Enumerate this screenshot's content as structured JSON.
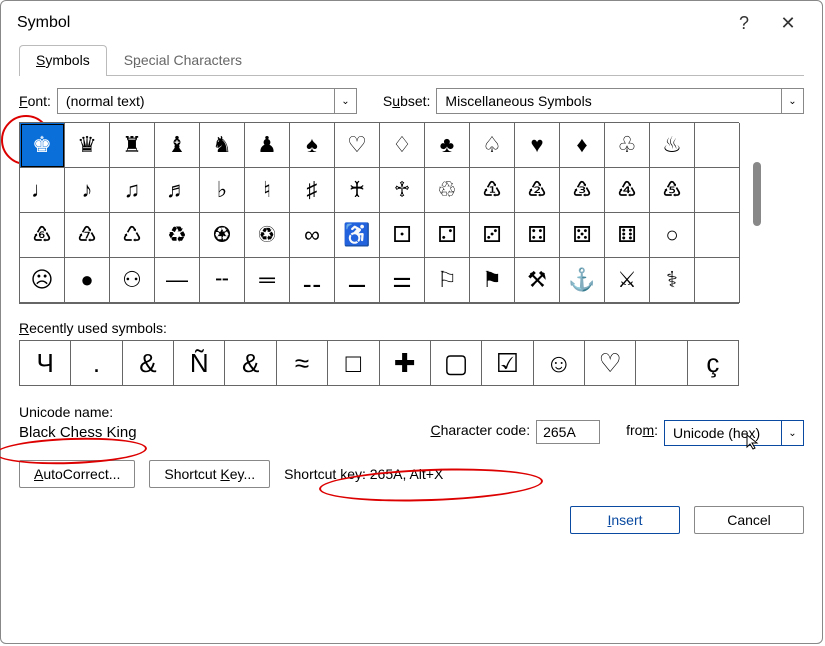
{
  "title": "Symbol",
  "help_glyph": "?",
  "close_glyph": "✕",
  "tabs": {
    "symbols": "Symbols",
    "special": "Special Characters"
  },
  "font_label": "Font:",
  "font_value": "(normal text)",
  "subset_label": "Subset:",
  "subset_value": "Miscellaneous Symbols",
  "grid": [
    [
      "♚",
      "♛",
      "♜",
      "♝",
      "♞",
      "♟",
      "♠",
      "♡",
      "♢",
      "♣",
      "♤",
      "♥",
      "♦",
      "♧",
      "♨"
    ],
    [
      "♩",
      "♪",
      "♫",
      "♬",
      "♭",
      "♮",
      "♯",
      "♰",
      "♱",
      "♲",
      "♳",
      "♴",
      "♵",
      "♶",
      "♷"
    ],
    [
      "♸",
      "♹",
      "♺",
      "♻",
      "♼",
      "♽",
      "∞",
      "♿",
      "⚀",
      "⚁",
      "⚂",
      "⚃",
      "⚄",
      "⚅",
      "○"
    ],
    [
      "☹",
      "●",
      "⚇",
      "—",
      "╌",
      "═",
      "⚋",
      "⚊",
      "⚌",
      "⚐",
      "⚑",
      "⚒",
      "⚓",
      "⚔",
      "⚕"
    ]
  ],
  "recent_label": "Recently used symbols:",
  "recent": [
    "Ч",
    ".",
    "&",
    "Ñ",
    "&",
    "≈",
    "□",
    "✚",
    "▢",
    "☑",
    "☺",
    "♡",
    "",
    "ç"
  ],
  "unicode_name_label": "Unicode name:",
  "unicode_name": "Black Chess King",
  "char_code_label": "Character code:",
  "char_code": "265A",
  "from_label": "from:",
  "from_value": "Unicode (hex)",
  "autocorrect_btn": "AutoCorrect...",
  "shortcut_key_btn": "Shortcut Key...",
  "shortcut_text": "Shortcut key: 265A, Alt+X",
  "insert_btn": "Insert",
  "cancel_btn": "Cancel",
  "dd_glyph": "⌄"
}
